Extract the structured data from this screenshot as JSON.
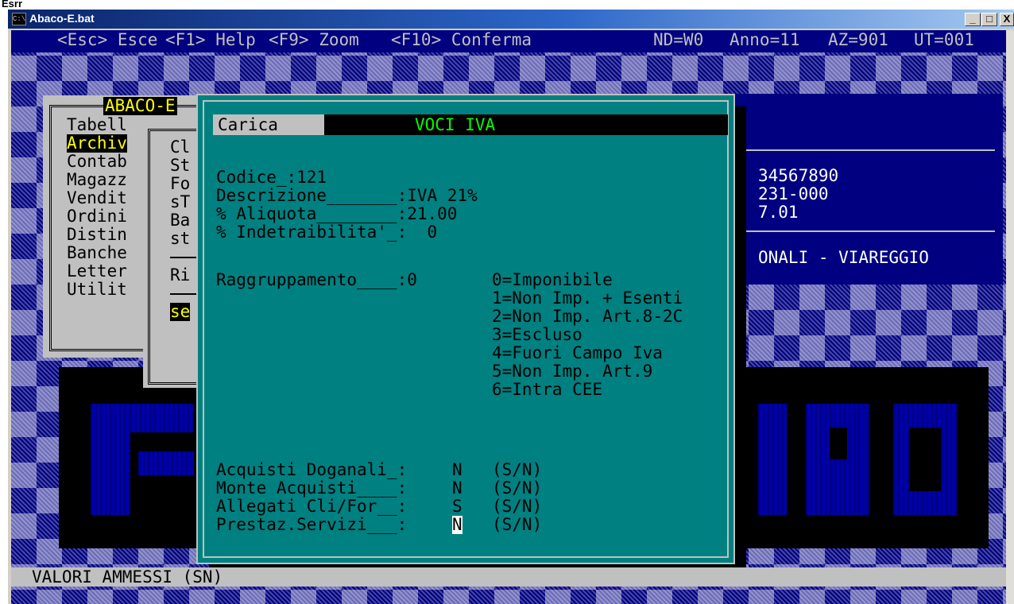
{
  "corner_label": "Esrr",
  "window": {
    "title": "Abaco-E.bat",
    "icon": "console-icon",
    "buttons": {
      "minimize": "_",
      "maximize": "□",
      "close": "X"
    }
  },
  "topbar": {
    "esc": "<Esc> Esce",
    "f1": "<F1> Help",
    "f9": "<F9> Zoom",
    "f10": "<F10> Conferma",
    "nd": "ND=W0",
    "anno": "Anno=11",
    "az": "AZ=901",
    "ut": "UT=001"
  },
  "main_menu": {
    "title": "ABACO-E",
    "items": [
      "Tabell",
      "Archiv",
      "Contab",
      "Magazz",
      "Vendit",
      "Ordini",
      "Distin",
      "Banche",
      "Letter",
      "Utilit"
    ],
    "selected": "Archiv"
  },
  "sub_menu": {
    "items": [
      "Cl",
      "St",
      "Fo",
      "sT",
      "Ba",
      "st",
      "",
      "Ri",
      ""
    ],
    "selected": "se"
  },
  "right_panel": {
    "line1": "34567890",
    "line2": "231-000",
    "line3": "7.01",
    "line4": "ONALI - VIAREGGIO"
  },
  "dialog": {
    "mode": "Carica",
    "title": "VOCI IVA",
    "fields": {
      "codice": "Codice_:121",
      "descrizione": "Descrizione_______:IVA 21%",
      "aliquota": "% Aliquota________:21.00",
      "indetraibilita": "% Indetraibilita'_:  0",
      "raggruppamento": "Raggruppamento____:0"
    },
    "raggruppamento_options": [
      "0=Imponibile",
      "1=Non Imp. + Esenti",
      "2=Non Imp. Art.8-2C",
      "3=Escluso",
      "4=Fuori Campo Iva",
      "5=Non Imp. Art.9",
      "6=Intra CEE"
    ],
    "flags": [
      {
        "label": "Acquisti Doganali_:",
        "value": "N",
        "hint": "(S/N)"
      },
      {
        "label": "Monte Acquisti____:",
        "value": "N",
        "hint": "(S/N)"
      },
      {
        "label": "Allegati Cli/For__:",
        "value": "S",
        "hint": "(S/N)"
      },
      {
        "label": "Prestaz.Servizi___:",
        "value": "N",
        "hint": "(S/N)"
      }
    ]
  },
  "status_bar": {
    "message": "VALORI AMMESSI (SN)"
  },
  "colors": {
    "console_bg": "#000080",
    "dialog_bg": "#008080",
    "title_text": "#00ff00",
    "highlight_text": "#ffff00"
  }
}
